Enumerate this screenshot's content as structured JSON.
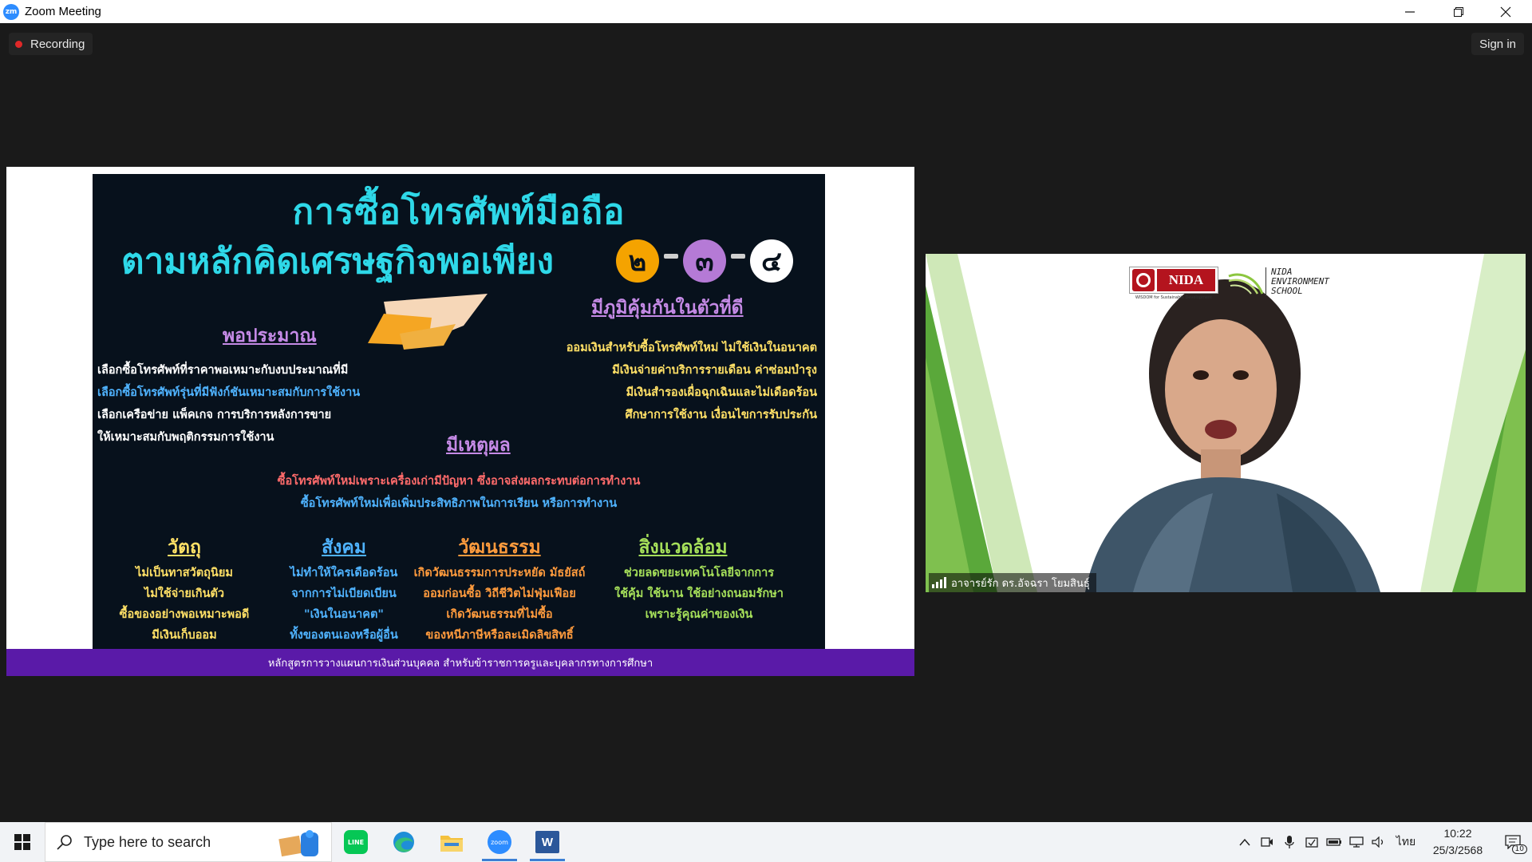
{
  "window": {
    "title": "Zoom Meeting",
    "app_icon_text": "zm"
  },
  "meeting": {
    "recording_label": "Recording",
    "signin_label": "Sign in"
  },
  "slide": {
    "title_line1": "การซื้อโทรศัพท์มือถือ",
    "title_line2": "ตามหลักคิดเศรษฐกิจพอเพียง",
    "badges": [
      "๒",
      "๓",
      "๔"
    ],
    "badge_colors": [
      "#f5a300",
      "#b57ad6",
      "#ffffff"
    ],
    "section_moderate": {
      "heading": "พอประมาณ",
      "lines": [
        "เลือกซื้อโทรศัพท์ที่ราคาพอเหมาะกับงบประมาณที่มี",
        "เลือกซื้อโทรศัพท์รุ่นที่มีฟังก์ชันเหมาะสมกับการใช้งาน",
        "เลือกเครือข่าย แพ็คเกจ การบริการหลังการขาย",
        "ให้เหมาะสมกับพฤติกรรมการใช้งาน"
      ]
    },
    "section_immunity": {
      "heading": "มีภูมิคุ้มกันในตัวที่ดี",
      "lines": [
        "ออมเงินสำหรับซื้อโทรศัพท์ใหม่ ไม่ใช้เงินในอนาคต",
        "มีเงินจ่ายค่าบริการรายเดือน ค่าซ่อมบำรุง",
        "มีเงินสำรองเผื่อฉุกเฉินและไม่เดือดร้อน",
        "ศึกษาการใช้งาน เงื่อนไขการรับประกัน"
      ]
    },
    "section_reason": {
      "heading": "มีเหตุผล",
      "lines": [
        "ซื้อโทรศัพท์ใหม่เพราะเครื่องเก่ามีปัญหา ซึ่งอาจส่งผลกระทบต่อการทำงาน",
        "ซื้อโทรศัพท์ใหม่เพื่อเพิ่มประสิทธิภาพในการเรียน หรือการทำงาน"
      ]
    },
    "columns": [
      {
        "heading": "วัตถุ",
        "lines": [
          "ไม่เป็นทาสวัตถุนิยม",
          "ไม่ใช้จ่ายเกินตัว",
          "ซื้อของอย่างพอเหมาะพอดี",
          "มีเงินเก็บออม"
        ]
      },
      {
        "heading": "สังคม",
        "lines": [
          "ไม่ทำให้ใครเดือดร้อน",
          "จากการไม่เบียดเบียน",
          "\"เงินในอนาคต\"",
          "ทั้งของตนเองหรือผู้อื่น"
        ]
      },
      {
        "heading": "วัฒนธรรม",
        "lines": [
          "เกิดวัฒนธรรมการประหยัด มัธยัสถ์",
          "ออมก่อนซื้อ วิถีชีวิตไม่ฟุ่มเฟือย",
          "เกิดวัฒนธรรมที่ไม่ซื้อ",
          "ของหนีภาษีหรือละเมิดลิขสิทธิ์"
        ]
      },
      {
        "heading": "สิ่งแวดล้อม",
        "lines": [
          "ช่วยลดขยะเทคโนโลยีจากการ",
          "ใช้คุ้ม ใช้นาน ใช้อย่างถนอมรักษา",
          "เพราะรู้คุณค่าของเงิน"
        ]
      }
    ],
    "footer": "หลักสูตรการวางแผนการเงินส่วนบุคคล สำหรับข้าราชการครูและบุคลากรทางการศึกษา"
  },
  "video": {
    "logo_text": "NIDA",
    "logo_tagline": "WISDOM for Sustainable Development",
    "school_line1": "NIDA",
    "school_line2": "ENVIRONMENT",
    "school_line3": "SCHOOL",
    "participant_name": "อาจารย์รัก ดร.อัจฉรา โยมสินธุ์"
  },
  "taskbar": {
    "search_placeholder": "Type here to search",
    "apps": [
      "notes-app",
      "line-app",
      "edge-app",
      "file-explorer-app",
      "zoom-app",
      "word-app"
    ],
    "zoom_label": "zoom",
    "word_label": "W",
    "line_label": "LINE",
    "lang": "ไทย",
    "time": "10:22",
    "date": "25/3/2568",
    "notification_count": "10"
  },
  "colors": {
    "slide_bg": "#07111c",
    "title_cyan": "#2ed8e8",
    "heading_purple": "#c58ae6",
    "footer_purple": "#5a1aa8",
    "zoom_blue": "#2d8cff"
  }
}
